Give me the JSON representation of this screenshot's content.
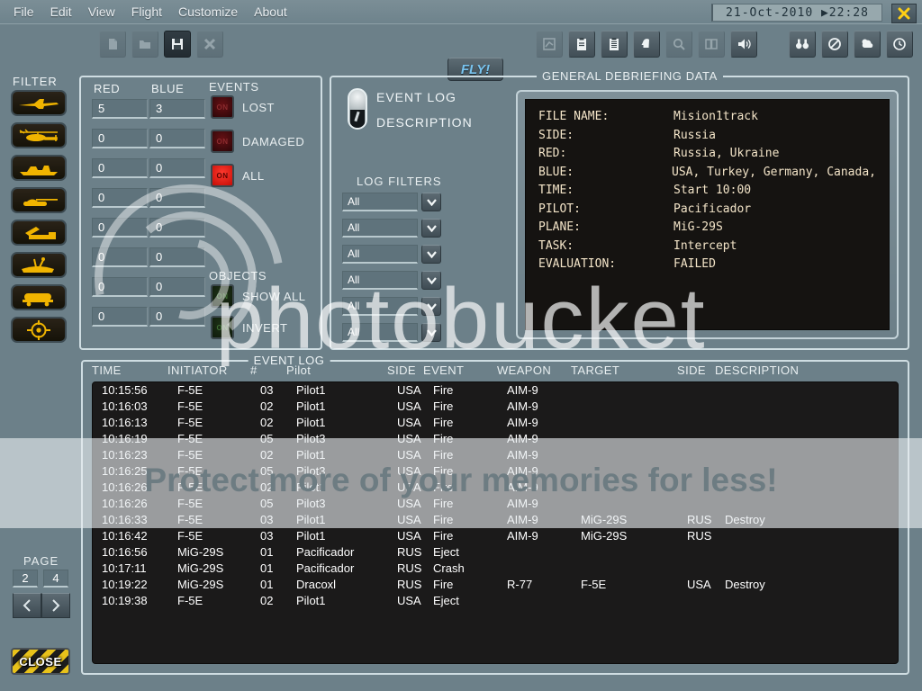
{
  "window": {
    "datetime": "21-Oct-2010  ▶22:28",
    "close_icon": "x-close-icon"
  },
  "menu": {
    "items": [
      "File",
      "Edit",
      "View",
      "Flight",
      "Customize",
      "About"
    ]
  },
  "file_toolbar": [
    {
      "name": "new-file-icon",
      "enabled": false
    },
    {
      "name": "open-file-icon",
      "enabled": false
    },
    {
      "name": "save-file-icon",
      "enabled": true
    },
    {
      "name": "close-file-icon",
      "enabled": false
    }
  ],
  "main_toolbar": {
    "fly_label": "FLY!",
    "icons": [
      {
        "name": "chart-icon",
        "enabled": false
      },
      {
        "name": "clipboard-icon",
        "enabled": true
      },
      {
        "name": "briefing-list-icon",
        "enabled": true
      },
      {
        "name": "pilot-head-icon",
        "enabled": true
      },
      {
        "name": "search-icon",
        "enabled": false
      },
      {
        "name": "book-icon",
        "enabled": false
      },
      {
        "name": "speaker-icon",
        "enabled": true
      },
      {
        "name": "binoculars-icon",
        "enabled": true
      },
      {
        "name": "no-entry-icon",
        "enabled": true
      },
      {
        "name": "weather-icon",
        "enabled": true
      },
      {
        "name": "clock-icon",
        "enabled": true
      }
    ]
  },
  "filter": {
    "title": "FILTER",
    "buttons": [
      {
        "name": "filter-plane-icon"
      },
      {
        "name": "filter-helicopter-icon"
      },
      {
        "name": "filter-ship-icon"
      },
      {
        "name": "filter-tank-icon"
      },
      {
        "name": "filter-artillery-icon"
      },
      {
        "name": "filter-sam-site-icon"
      },
      {
        "name": "filter-vehicle-icon"
      },
      {
        "name": "filter-target-icon"
      }
    ]
  },
  "counters": {
    "red_label": "RED",
    "blue_label": "BLUE",
    "red": [
      "5",
      "0",
      "0",
      "0",
      "0",
      "0",
      "0",
      "0"
    ],
    "blue": [
      "3",
      "0",
      "0",
      "0",
      "0",
      "0",
      "0",
      "0"
    ]
  },
  "events": {
    "title": "EVENTS",
    "items": [
      {
        "label": "LOST",
        "state": "off",
        "led_text": "ON"
      },
      {
        "label": "DAMAGED",
        "state": "off",
        "led_text": "ON"
      },
      {
        "label": "ALL",
        "state": "on",
        "led_text": "ON"
      }
    ]
  },
  "objects": {
    "title": "OBJECTS",
    "items": [
      {
        "label": "SHOW ALL",
        "state": "off",
        "led_text": "ON"
      },
      {
        "label": "INVERT",
        "state": "off",
        "led_text": "ON"
      }
    ]
  },
  "view_toggle": {
    "option_top": "EVENT LOG",
    "option_bottom": "DESCRIPTION",
    "selected": "EVENT LOG"
  },
  "log_filters": {
    "title": "LOG FILTERS",
    "values": [
      "All",
      "All",
      "All",
      "All",
      "All",
      "All"
    ]
  },
  "debriefing": {
    "title": "GENERAL DEBRIEFING DATA",
    "rows": [
      {
        "key": "FILE NAME:",
        "value": "Mision1track"
      },
      {
        "key": "SIDE:",
        "value": "Russia"
      },
      {
        "key": "RED:",
        "value": "Russia, Ukraine"
      },
      {
        "key": "BLUE:",
        "value": "USA, Turkey, Germany, Canada,"
      },
      {
        "key": "TIME:",
        "value": "Start 10:00"
      },
      {
        "key": "PILOT:",
        "value": "Pacificador"
      },
      {
        "key": "PLANE:",
        "value": "MiG-29S"
      },
      {
        "key": "TASK:",
        "value": "Intercept"
      },
      {
        "key": "EVALUATION:",
        "value": "FAILED"
      }
    ]
  },
  "event_log": {
    "title": "EVENT LOG",
    "columns": [
      "TIME",
      "INITIATOR",
      "#",
      "Pilot",
      "SIDE",
      "EVENT",
      "WEAPON",
      "TARGET",
      "SIDE",
      "DESCRIPTION"
    ],
    "rows": [
      {
        "time": "10:15:56",
        "initiator": "F-5E",
        "num": "03",
        "pilot": "Pilot1",
        "side": "USA",
        "event": "Fire",
        "weapon": "AIM-9",
        "target": "",
        "tside": "",
        "description": ""
      },
      {
        "time": "10:16:03",
        "initiator": "F-5E",
        "num": "02",
        "pilot": "Pilot1",
        "side": "USA",
        "event": "Fire",
        "weapon": "AIM-9",
        "target": "",
        "tside": "",
        "description": ""
      },
      {
        "time": "10:16:13",
        "initiator": "F-5E",
        "num": "02",
        "pilot": "Pilot1",
        "side": "USA",
        "event": "Fire",
        "weapon": "AIM-9",
        "target": "",
        "tside": "",
        "description": ""
      },
      {
        "time": "10:16:19",
        "initiator": "F-5E",
        "num": "05",
        "pilot": "Pilot3",
        "side": "USA",
        "event": "Fire",
        "weapon": "AIM-9",
        "target": "",
        "tside": "",
        "description": ""
      },
      {
        "time": "10:16:23",
        "initiator": "F-5E",
        "num": "02",
        "pilot": "Pilot1",
        "side": "USA",
        "event": "Fire",
        "weapon": "AIM-9",
        "target": "",
        "tside": "",
        "description": ""
      },
      {
        "time": "10:16:25",
        "initiator": "F-5E",
        "num": "05",
        "pilot": "Pilot3",
        "side": "USA",
        "event": "Fire",
        "weapon": "AIM-9",
        "target": "",
        "tside": "",
        "description": ""
      },
      {
        "time": "10:16:26",
        "initiator": "F-5E",
        "num": "02",
        "pilot": "Pilot1",
        "side": "USA",
        "event": "Fire",
        "weapon": "AIM-9",
        "target": "",
        "tside": "",
        "description": ""
      },
      {
        "time": "10:16:26",
        "initiator": "F-5E",
        "num": "05",
        "pilot": "Pilot3",
        "side": "USA",
        "event": "Fire",
        "weapon": "AIM-9",
        "target": "",
        "tside": "",
        "description": ""
      },
      {
        "time": "10:16:33",
        "initiator": "F-5E",
        "num": "03",
        "pilot": "Pilot1",
        "side": "USA",
        "event": "Fire",
        "weapon": "AIM-9",
        "target": "MiG-29S",
        "tside": "RUS",
        "description": "Destroy"
      },
      {
        "time": "10:16:42",
        "initiator": "F-5E",
        "num": "03",
        "pilot": "Pilot1",
        "side": "USA",
        "event": "Fire",
        "weapon": "AIM-9",
        "target": "MiG-29S",
        "tside": "RUS",
        "description": ""
      },
      {
        "time": "10:16:56",
        "initiator": "MiG-29S",
        "num": "01",
        "pilot": "Pacificador",
        "side": "RUS",
        "event": "Eject",
        "weapon": "",
        "target": "",
        "tside": "",
        "description": ""
      },
      {
        "time": "10:17:11",
        "initiator": "MiG-29S",
        "num": "01",
        "pilot": "Pacificador",
        "side": "RUS",
        "event": "Crash",
        "weapon": "",
        "target": "",
        "tside": "",
        "description": ""
      },
      {
        "time": "10:19:22",
        "initiator": "MiG-29S",
        "num": "01",
        "pilot": "Dracoxl",
        "side": "RUS",
        "event": "Fire",
        "weapon": "R-77",
        "target": "F-5E",
        "tside": "USA",
        "description": "Destroy"
      },
      {
        "time": "10:19:38",
        "initiator": "F-5E",
        "num": "02",
        "pilot": "Pilot1",
        "side": "USA",
        "event": "Eject",
        "weapon": "",
        "target": "",
        "tside": "",
        "description": ""
      }
    ]
  },
  "pagination": {
    "title": "PAGE",
    "current": "2",
    "total": "4",
    "prev_icon": "chevron-left-icon",
    "next_icon": "chevron-right-icon"
  },
  "close_button": {
    "label": "CLOSE"
  },
  "watermark": {
    "big": "photobucket",
    "tagline": "Protect more of your memories for less!"
  },
  "colors": {
    "bg": "#6c8089",
    "accent_yellow": "#e8c21a",
    "led_on_red": "#ff3a2e",
    "fly_text": "#79c4ef",
    "terminal_text": "#f3e4c8"
  }
}
